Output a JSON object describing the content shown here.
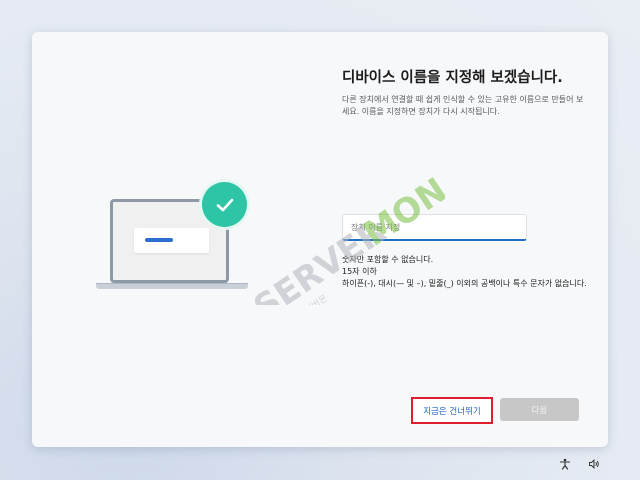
{
  "dialog": {
    "title": "디바이스 이름을 지정해 보겠습니다.",
    "description": "다른 장치에서 연결할 때 쉽게 인식할 수 있는 고유한 이름으로 만들어 보세요. 이름을 지정하면 장치가 다시 시작됩니다.",
    "name_input": {
      "placeholder": "장치 이름 지정",
      "value": ""
    },
    "rules": [
      "숫자만 포함할 수 없습니다.",
      "15자 이하",
      "하이픈(-), 대시(— 및 –), 밑줄(_) 이외의 공백이나 특수 문자가 없습니다."
    ],
    "skip_button": "지금은 건너뛰기",
    "next_button": "다음"
  },
  "watermark": {
    "brand_a": "SERVER",
    "brand_b": "MON",
    "sub": "주식회사 서버몬"
  },
  "taskbar": {
    "icons": [
      "accessibility-icon",
      "volume-icon"
    ]
  },
  "colors": {
    "accent": "#1f6fc6",
    "check": "#2ec4a6",
    "highlight_box": "#e01e2d",
    "disabled_button": "#c7c7c7",
    "watermark_green": "#7ac143"
  }
}
